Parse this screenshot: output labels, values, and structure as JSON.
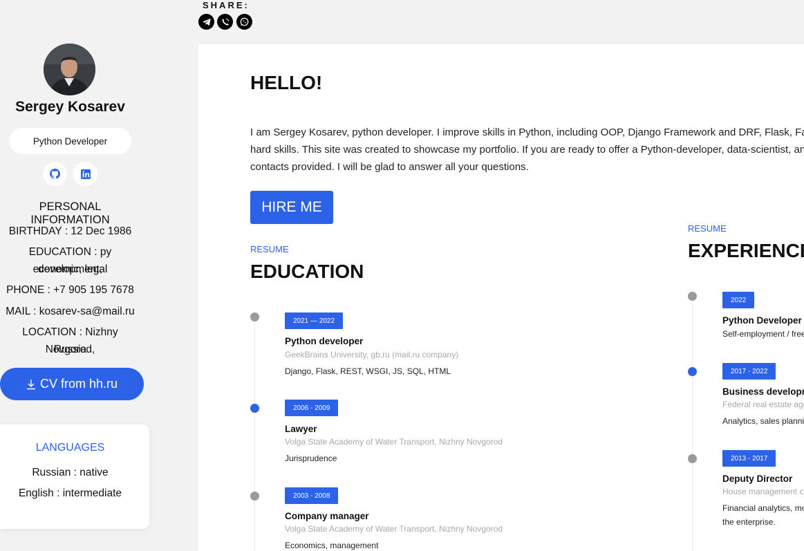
{
  "share": {
    "label": "SHARE:",
    "icons": [
      "telegram-icon",
      "viber-icon",
      "whatsapp-icon"
    ]
  },
  "profile": {
    "name": "Sergey Kosarev",
    "role": "Python Developer",
    "socials": [
      "github-icon",
      "linkedin-icon"
    ],
    "personal_title": "PERSONAL INFORMATION",
    "birthday": "BIRTHDAY : 12 Dec 1986",
    "education_l1": "EDUCATION : py development,",
    "education_l2": "economic, legal",
    "phone": "PHONE : +7 905 195 7678",
    "mail": "MAIL : kosarev-sa@mail.ru",
    "location_l1": "LOCATION : Nizhny Novgorod,",
    "location_l2": "Russia",
    "cv_button": "CV from hh.ru"
  },
  "languages": {
    "title": "LANGUAGES",
    "items": [
      "Russian : native",
      "English : intermediate"
    ]
  },
  "main": {
    "hello": "HELLO!",
    "intro_lines": [
      "I am Sergey Kosarev, python developer. I improve skills in Python, including OOP, Django Framework and DRF, Flask, FastAP",
      "hard skills. This site was created to showcase my portfolio. If you are ready to offer a Python-developer, data-scientist, ana",
      "contacts provided. I will be glad to answer all your questions."
    ],
    "hire_button": "HIRE ME"
  },
  "education": {
    "kicker": "RESUME",
    "title": "EDUCATION",
    "items": [
      {
        "years": "2021 — 2022",
        "title": "Python developer",
        "place": "GeekBrains University, gb.ru (mail.ru company)",
        "desc": "Django, Flask, REST, WSGI, JS, SQL, HTML",
        "active": false
      },
      {
        "years": "2006 - 2009",
        "title": "Lawyer",
        "place": "Volga State Academy of Water Transport, Nizhny Novgorod",
        "desc": "Jurisprudence",
        "active": true
      },
      {
        "years": "2003 - 2008",
        "title": "Company manager",
        "place": "Volga State Academy of Water Transport, Nizhny Novgorod",
        "desc": "Economics, management",
        "active": false
      }
    ]
  },
  "experience": {
    "kicker": "RESUME",
    "title": "EXPERIENCE",
    "items": [
      {
        "years": "2022",
        "title": "Python Developer",
        "place": "Self-employment / free",
        "desc": "",
        "active": false
      },
      {
        "years": "2017 - 2022",
        "title": "Business developm",
        "place": "Federal real estate age",
        "desc": "Analytics, sales planning",
        "active": true
      },
      {
        "years": "2013 - 2017",
        "title": "Deputy Director",
        "place": "House management co",
        "desc": "Financial analytics, moc",
        "desc2": "the enterprise.",
        "active": false
      }
    ]
  },
  "colors": {
    "accent": "#2c62e8",
    "page_bg": "#f2f2f2",
    "muted": "#a8a8a8"
  }
}
